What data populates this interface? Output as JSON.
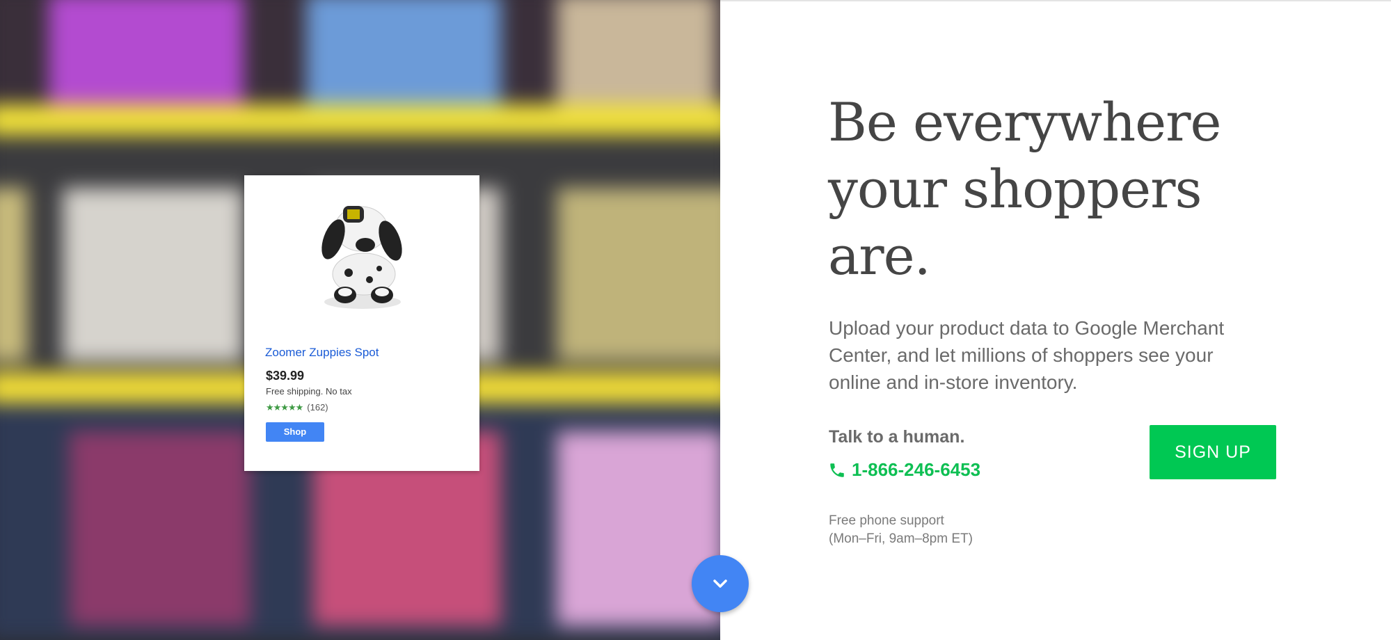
{
  "product_card": {
    "title": "Zoomer Zuppies Spot",
    "price": "$39.99",
    "shipping": "Free shipping. No tax",
    "stars": "★★★★★",
    "rating_count": "(162)",
    "shop_label": "Shop"
  },
  "hero": {
    "headline_line1": "Be everywhere",
    "headline_line2": "your shoppers",
    "headline_line3": "are.",
    "subtext": "Upload your product data to Google Merchant Center, and let millions of shoppers see your online and in-store inventory."
  },
  "contact": {
    "talk_label": "Talk to a human.",
    "phone": "1-866-246-6453",
    "support_line1": "Free phone support",
    "support_line2": "(Mon–Fri, 9am–8pm ET)"
  },
  "cta": {
    "signup_label": "SIGN UP"
  },
  "icons": {
    "phone": "phone-icon",
    "scroll": "chevron-down-icon"
  },
  "colors": {
    "accent_blue": "#4285f4",
    "cta_green": "#00c853",
    "phone_green": "#0ebf53",
    "title_blue": "#1a5bd6"
  }
}
